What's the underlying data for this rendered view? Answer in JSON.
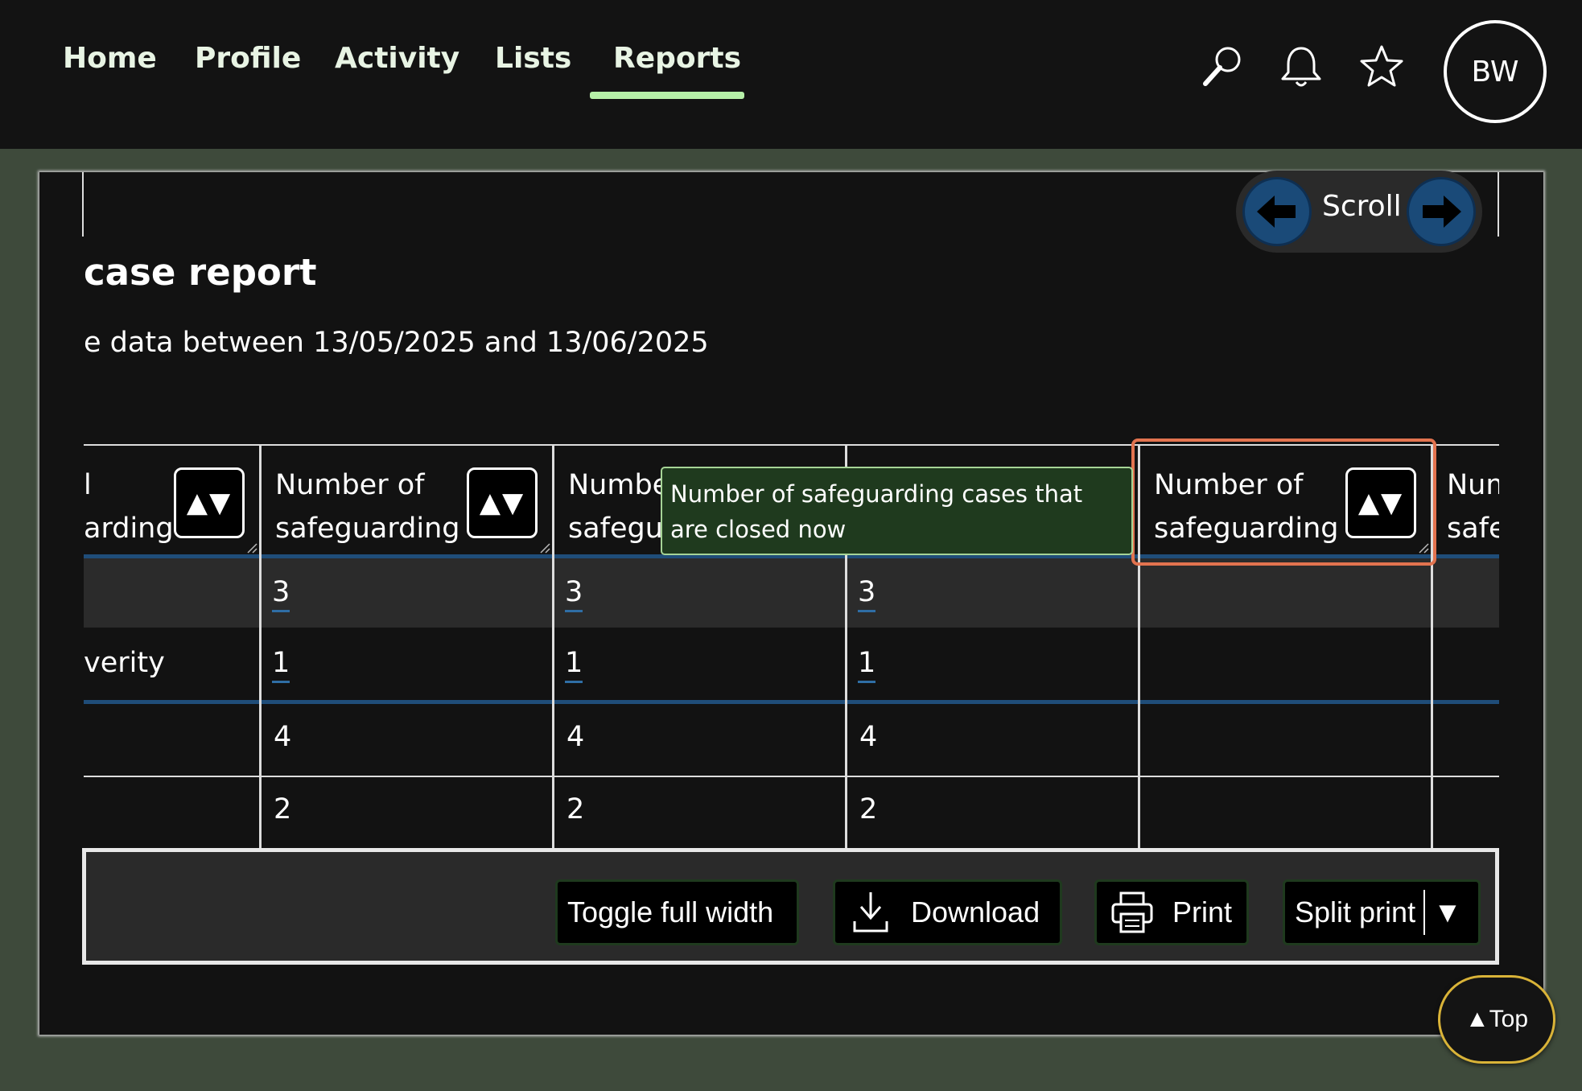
{
  "nav": {
    "items": [
      {
        "label": "Home"
      },
      {
        "label": "Profile"
      },
      {
        "label": "Activity"
      },
      {
        "label": "Lists"
      },
      {
        "label": "Reports"
      }
    ],
    "active": "Reports",
    "avatar_initials": "BW",
    "accent_color": "#b6f0a8"
  },
  "scroll": {
    "label": "Scroll"
  },
  "report": {
    "title_partial": "case report",
    "subtitle_partial": "e data between 13/05/2025 and 13/06/2025"
  },
  "table": {
    "headers": [
      {
        "line1": "l",
        "line2": "arding",
        "sort_icon": "▲▼"
      },
      {
        "line1": "Number of",
        "line2": "safeguarding",
        "sort_icon": "▲▼"
      },
      {
        "line1": "Numbe",
        "line2": "safegu",
        "sort_icon": ""
      },
      {
        "line1": "",
        "line2": "",
        "sort_icon": ""
      },
      {
        "line1": "Number of",
        "line2": "safeguarding",
        "sort_icon": "▲▼"
      },
      {
        "line1": "Num",
        "line2": "safe",
        "sort_icon": ""
      }
    ],
    "rows": [
      {
        "label": "",
        "values": [
          "3",
          "3",
          "3",
          "",
          ""
        ]
      },
      {
        "label": "verity",
        "values": [
          "1",
          "1",
          "1",
          "",
          ""
        ]
      },
      {
        "label": "",
        "values": [
          "4",
          "4",
          "4",
          "",
          ""
        ]
      },
      {
        "label": "",
        "values": [
          "2",
          "2",
          "2",
          "",
          ""
        ]
      }
    ]
  },
  "tooltip": {
    "text": "Number of safeguarding cases that are closed now"
  },
  "toolbar": {
    "toggle_label": "Toggle full width",
    "download_label": "Download",
    "print_label": "Print",
    "split_print_label": "Split print",
    "split_print_arrow": "▼"
  },
  "top_button": {
    "label": "▲Top"
  }
}
